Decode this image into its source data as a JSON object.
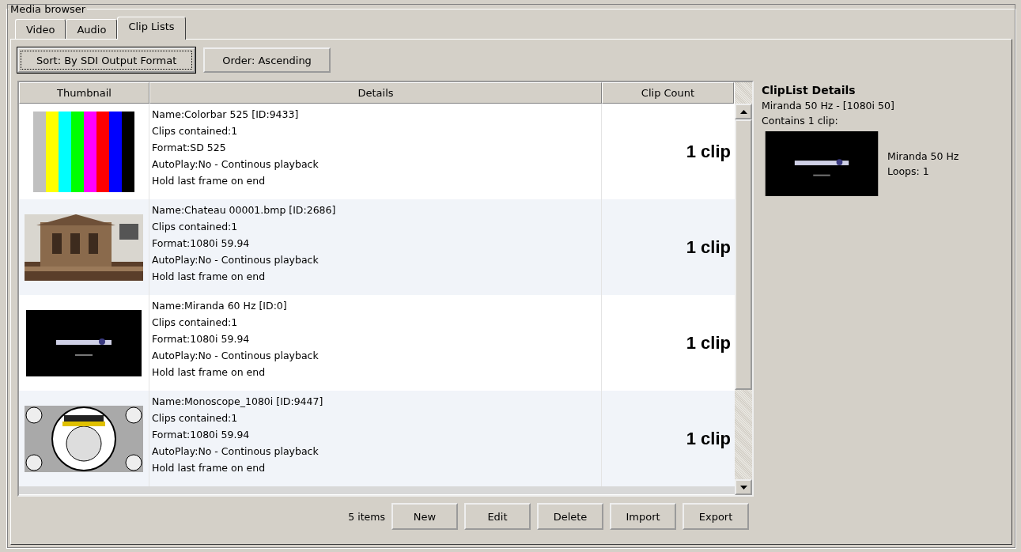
{
  "group_title": "Media browser",
  "tabs": [
    {
      "label": "Video",
      "selected": false
    },
    {
      "label": "Audio",
      "selected": false
    },
    {
      "label": "Clip Lists",
      "selected": true
    }
  ],
  "toolbar": [
    {
      "label": "Sort: By SDI Output Format",
      "focused": true
    },
    {
      "label": "Order: Ascending",
      "focused": false
    }
  ],
  "table": {
    "columns": [
      "Thumbnail",
      "Details",
      "Clip Count"
    ],
    "rows": [
      {
        "details": [
          "Name:Colorbar 525 [ID:9433]",
          "Clips contained:1",
          "Format:SD 525",
          "AutoPlay:No - Continous playback",
          "Hold last frame on end"
        ],
        "clip_count": "1 clip"
      },
      {
        "details": [
          "Name:Chateau 00001.bmp [ID:2686]",
          "Clips contained:1",
          "Format:1080i 59.94",
          "AutoPlay:No - Continous playback",
          "Hold last frame on end"
        ],
        "clip_count": "1 clip"
      },
      {
        "details": [
          "Name:Miranda 60 Hz [ID:0]",
          "Clips contained:1",
          "Format:1080i 59.94",
          "AutoPlay:No - Continous playback",
          "Hold last frame on end"
        ],
        "clip_count": "1 clip"
      },
      {
        "details": [
          "Name:Monoscope_1080i [ID:9447]",
          "Clips contained:1",
          "Format:1080i 59.94",
          "AutoPlay:No - Continous playback",
          "Hold last frame on end"
        ],
        "clip_count": "1 clip"
      }
    ]
  },
  "footer": {
    "count": "5 items",
    "buttons": [
      "New",
      "Edit",
      "Delete",
      "Import",
      "Export"
    ]
  },
  "details_panel": {
    "title": "ClipList Details",
    "subtitle": "Miranda 50 Hz - [1080i 50]",
    "contains": "Contains 1 clip:",
    "clip": {
      "name": "Miranda 50 Hz",
      "loops": "Loops: 1"
    }
  }
}
